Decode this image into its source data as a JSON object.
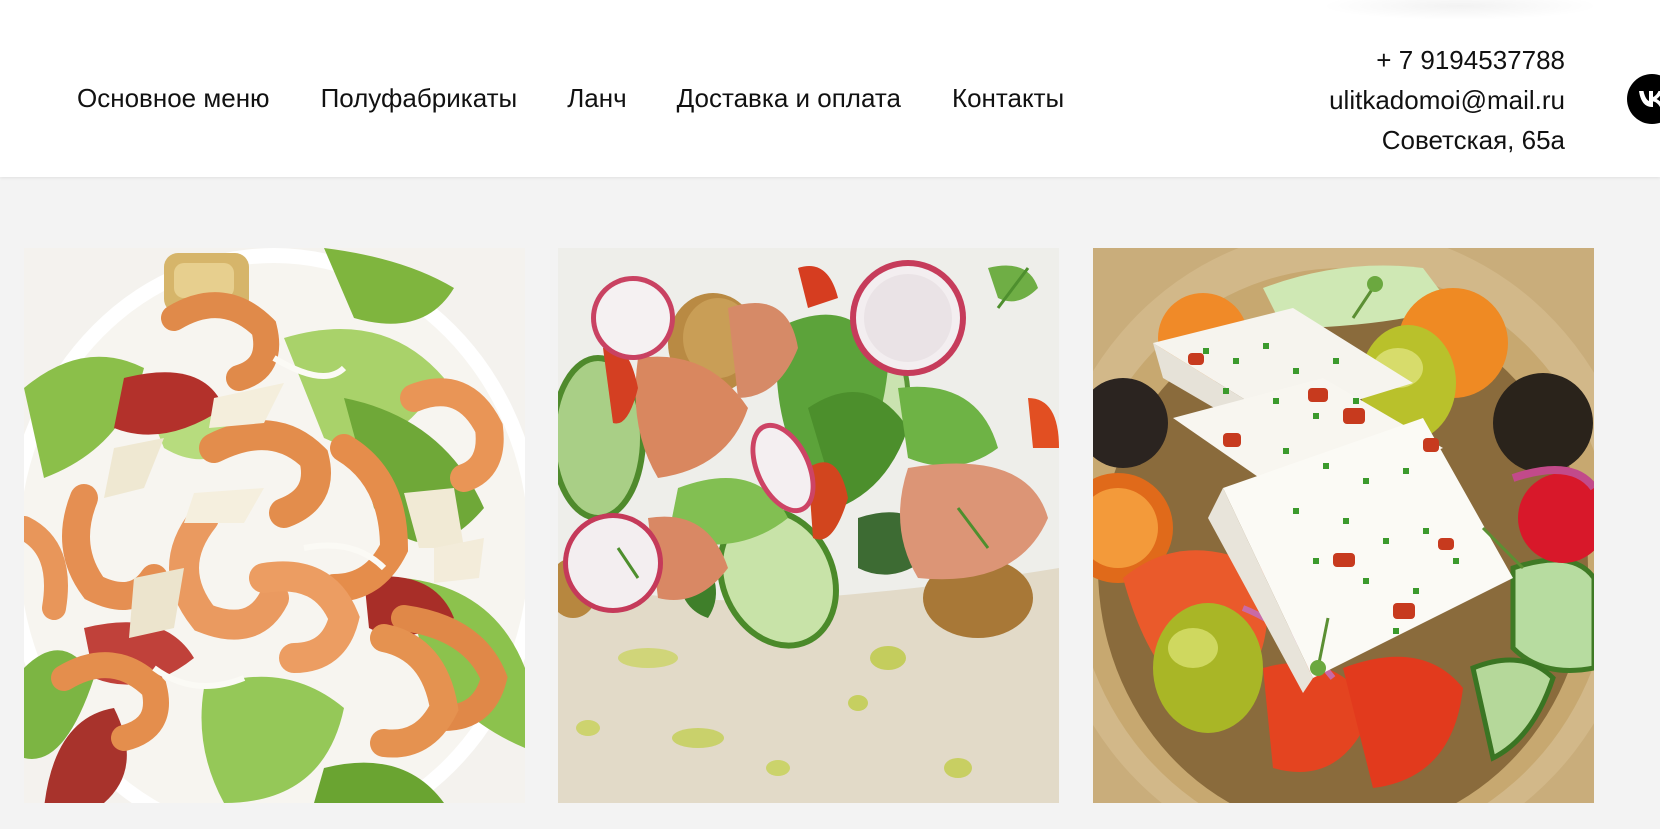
{
  "nav": {
    "items": [
      {
        "label": "Основное меню"
      },
      {
        "label": "Полуфабрикаты"
      },
      {
        "label": "Ланч"
      },
      {
        "label": "Доставка и оплата"
      },
      {
        "label": "Контакты"
      }
    ]
  },
  "contacts": {
    "phone": "+ 7 9194537788",
    "email": "ulitkadomoi@mail.ru",
    "address": "Советская, 65а"
  },
  "social": {
    "vk_icon": "vk-icon"
  },
  "gallery": {
    "items": [
      {
        "dish": "shrimp-caesar-salad-image"
      },
      {
        "dish": "salmon-radish-salad-image"
      },
      {
        "dish": "greek-salad-feta-image"
      }
    ]
  },
  "colors": {
    "header_bg": "#ffffff",
    "page_bg": "#f3f3f3",
    "text": "#111111",
    "vk_bg": "#000000"
  }
}
